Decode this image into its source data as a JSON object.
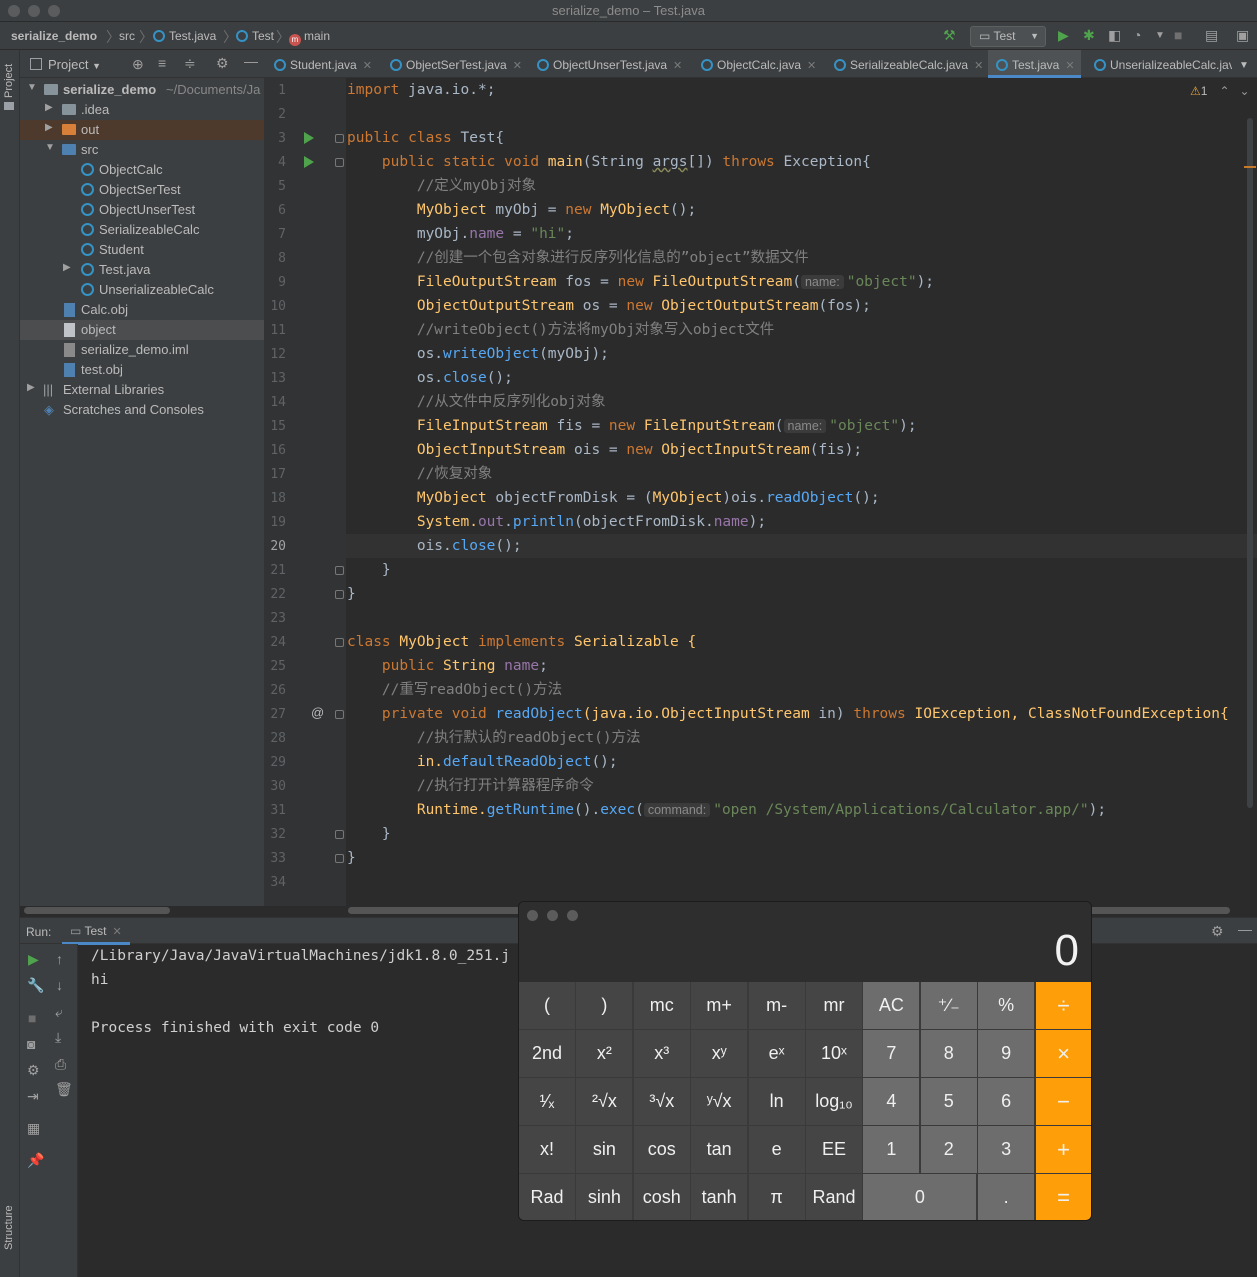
{
  "window": {
    "title": "serialize_demo – Test.java"
  },
  "breadcrumb": [
    "serialize_demo",
    "src",
    "Test.java",
    "Test",
    "main"
  ],
  "run_config": "Test",
  "project": {
    "header": "Project",
    "root": "serialize_demo",
    "root_path": "~/Documents/Ja",
    "items": [
      ".idea",
      "out",
      "src",
      "ObjectCalc",
      "ObjectSerTest",
      "ObjectUnserTest",
      "SerializeableCalc",
      "Student",
      "Test.java",
      "UnserializeableCalc",
      "Calc.obj",
      "object",
      "serialize_demo.iml",
      "test.obj",
      "External Libraries",
      "Scratches and Consoles"
    ]
  },
  "side_labels": {
    "project": "Project",
    "structure": "Structure"
  },
  "tabs": [
    "Student.java",
    "ObjectSerTest.java",
    "ObjectUnserTest.java",
    "ObjectCalc.java",
    "SerializeableCalc.java",
    "Test.java",
    "UnserializeableCalc.jav"
  ],
  "inspections": "1",
  "code": {
    "l1a": "import",
    "l1b": " java.io.*;",
    "l3a": "public class",
    "l3b": " Test{",
    "l4a": "    public static void",
    "l4b": " main",
    "l4c": "(String ",
    "l4d": "args",
    "l4e": "[]) ",
    "l4f": "throws",
    "l4g": " Exception{",
    "l5": "        //定义myObj对象",
    "l6a": "        MyObject",
    "l6b": " myObj = ",
    "l6c": "new",
    "l6d": " MyObject",
    "l6e": "();",
    "l7a": "        myObj.",
    "l7b": "name",
    "l7c": " = ",
    "l7d": "\"hi\"",
    "l7e": ";",
    "l8": "        //创建一个包含对象进行反序列化信息的”object”数据文件",
    "l9a": "        FileOutputStream",
    "l9b": " fos = ",
    "l9c": "new",
    "l9d": " FileOutputStream",
    "l9e": "(",
    "l9h": "name:",
    "l9f": "\"object\"",
    "l9g": ");",
    "l10a": "        ObjectOutputStream",
    "l10b": " os = ",
    "l10c": "new",
    "l10d": " ObjectOutputStream",
    "l10e": "(fos);",
    "l11": "        //writeObject()方法将myObj对象写入object文件",
    "l12a": "        os.",
    "l12b": "writeObject",
    "l12c": "(myObj);",
    "l13a": "        os.",
    "l13b": "close",
    "l13c": "();",
    "l14": "        //从文件中反序列化obj对象",
    "l15a": "        FileInputStream",
    "l15b": " fis = ",
    "l15c": "new",
    "l15d": " FileInputStream",
    "l15e": "(",
    "l15h": "name:",
    "l15f": "\"object\"",
    "l15g": ");",
    "l16a": "        ObjectInputStream",
    "l16b": " ois = ",
    "l16c": "new",
    "l16d": " ObjectInputStream",
    "l16e": "(fis);",
    "l17": "        //恢复对象",
    "l18a": "        MyObject",
    "l18b": " objectFromDisk = (",
    "l18c": "MyObject",
    "l18d": ")ois.",
    "l18e": "readObject",
    "l18f": "();",
    "l19a": "        System.",
    "l19b": "out",
    "l19c": ".",
    "l19d": "println",
    "l19e": "(objectFromDisk.",
    "l19f": "name",
    "l19g": ");",
    "l20a": "        ois.",
    "l20b": "close",
    "l20c": "();",
    "l21": "    }",
    "l22": "}",
    "l24a": "class",
    "l24b": " MyObject ",
    "l24c": "implements",
    "l24d": " Serializable {",
    "l25a": "    public",
    "l25b": " String ",
    "l25c": "name",
    "l25d": ";",
    "l26": "    //重写readObject()方法",
    "l27a": "    private void",
    "l27b": " readObject",
    "l27c": "(java.io.ObjectInputStream ",
    "l27d": "in",
    "l27e": ") ",
    "l27f": "throws",
    "l27g": " IOException, ClassNotFoundException{",
    "l28": "        //执行默认的readObject()方法",
    "l29a": "        in.",
    "l29b": "defaultReadObject",
    "l29c": "();",
    "l30": "        //执行打开计算器程序命令",
    "l31a": "        Runtime.",
    "l31b": "getRuntime",
    "l31c": "().",
    "l31d": "exec",
    "l31e": "(",
    "l31h": "command:",
    "l31f": "\"open /System/Applications/Calculator.app/\"",
    "l31g": ");",
    "l32": "    }",
    "l33": "}"
  },
  "run": {
    "label": "Run:",
    "tab": "Test",
    "lines": [
      "/Library/Java/JavaVirtualMachines/jdk1.8.0_251.j",
      "hi",
      "",
      "Process finished with exit code 0"
    ]
  },
  "calculator": {
    "display": "0",
    "rows": [
      [
        "(",
        ")",
        "mc",
        "m+",
        "m-",
        "mr",
        "AC",
        "⁺∕₋",
        "%",
        "÷"
      ],
      [
        "2nd",
        "x²",
        "x³",
        "xʸ",
        "eˣ",
        "10ˣ",
        "7",
        "8",
        "9",
        "×"
      ],
      [
        "¹⁄ₓ",
        "²√x",
        "³√x",
        "ʸ√x",
        "ln",
        "log₁₀",
        "4",
        "5",
        "6",
        "−"
      ],
      [
        "x!",
        "sin",
        "cos",
        "tan",
        "e",
        "EE",
        "1",
        "2",
        "3",
        "+"
      ],
      [
        "Rad",
        "sinh",
        "cosh",
        "tanh",
        "π",
        "Rand",
        "0",
        ".",
        "="
      ]
    ]
  }
}
